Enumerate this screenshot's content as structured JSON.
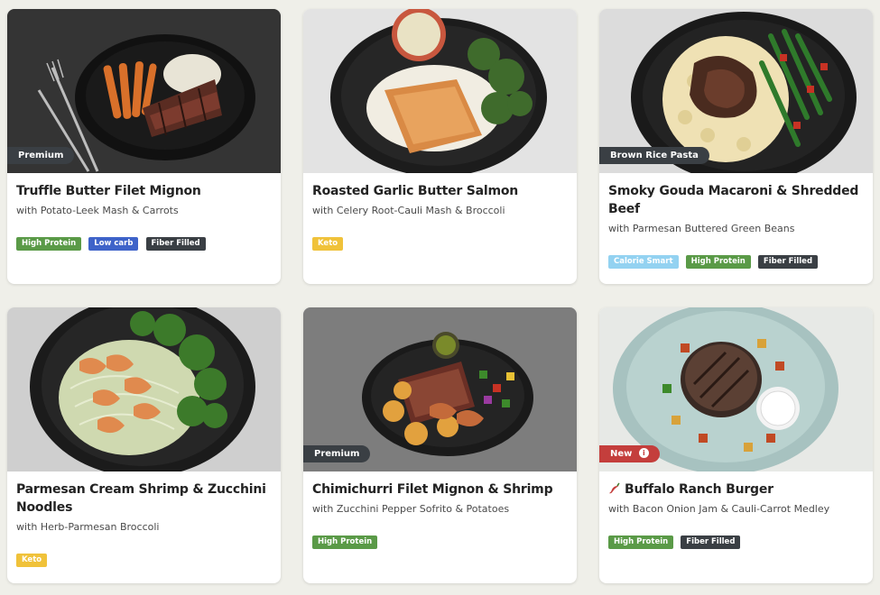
{
  "meals": [
    {
      "title": "Truffle Butter Filet Mignon",
      "subtitle": "with Potato-Leek Mash & Carrots",
      "badge": "Premium",
      "tags": [
        "High Protein",
        "Low carb",
        "Fiber Filled"
      ]
    },
    {
      "title": "Roasted Garlic Butter Salmon",
      "subtitle": "with Celery Root-Cauli Mash & Broccoli",
      "badge": "",
      "tags": [
        "Keto"
      ]
    },
    {
      "title": "Smoky Gouda Macaroni & Shredded Beef",
      "subtitle": "with Parmesan Buttered Green Beans",
      "badge": "Brown Rice Pasta",
      "tags": [
        "Calorie Smart",
        "High Protein",
        "Fiber Filled"
      ]
    },
    {
      "title": "Parmesan Cream Shrimp & Zucchini Noodles",
      "subtitle": "with Herb-Parmesan Broccoli",
      "badge": "",
      "tags": [
        "Keto"
      ]
    },
    {
      "title": "Chimichurri Filet Mignon & Shrimp",
      "subtitle": "with Zucchini Pepper Sofrito & Potatoes",
      "badge": "Premium",
      "tags": [
        "High Protein"
      ]
    },
    {
      "title": "Buffalo Ranch Burger",
      "subtitle": "with Bacon Onion Jam & Cauli-Carrot Medley",
      "badge": "New",
      "badge_icon": "info-icon",
      "title_icon": "chili-pepper-icon",
      "tags": [
        "High Protein",
        "Fiber Filled"
      ]
    }
  ],
  "colors": {
    "background": "#efefe9",
    "tag_green": "#5a9a47",
    "tag_blue": "#3e63c9",
    "tag_dark": "#3a3f44",
    "tag_yellow": "#f0c23a",
    "tag_light_blue": "#93d2f1",
    "badge_dark": "#3a3f44",
    "badge_new": "#c43e3c"
  }
}
